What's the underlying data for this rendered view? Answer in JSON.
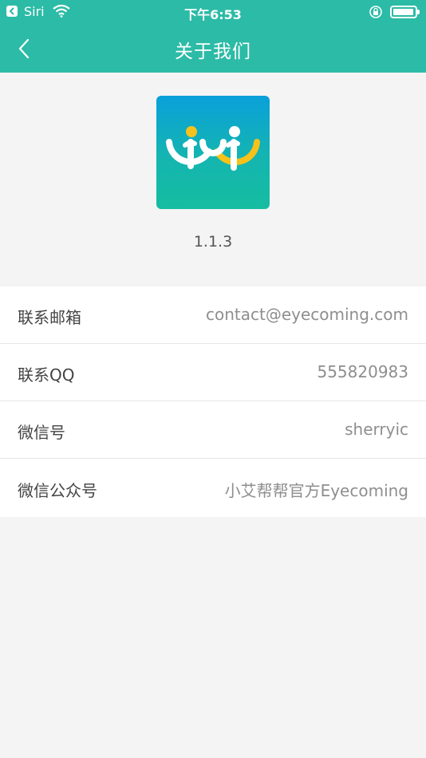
{
  "status_bar": {
    "carrier": "Siri",
    "time": "下午6:53",
    "battery_level": 0.9
  },
  "nav": {
    "title": "关于我们"
  },
  "app": {
    "version": "1.1.3",
    "logo_icon": "eyecoming-logo-icon"
  },
  "contacts": [
    {
      "label": "联系邮箱",
      "value": "contact@eyecoming.com"
    },
    {
      "label": "联系QQ",
      "value": "555820983"
    },
    {
      "label": "微信号",
      "value": "sherryic"
    },
    {
      "label": "微信公众号",
      "value": "小艾帮帮官方Eyecoming"
    }
  ],
  "colors": {
    "accent": "#2cbba6",
    "background": "#f4f4f4",
    "label_text": "#444444",
    "value_text": "#8e8e8e"
  }
}
